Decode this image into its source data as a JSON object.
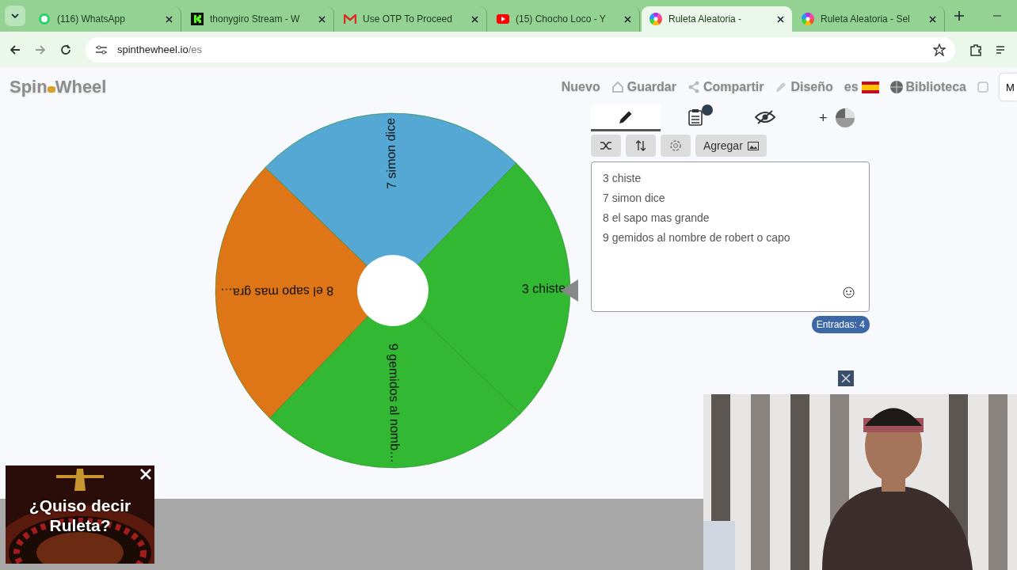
{
  "browser": {
    "tabs": [
      {
        "title": "(116) WhatsApp",
        "selected": false
      },
      {
        "title": "thonygiro Stream - W",
        "selected": false
      },
      {
        "title": "Use OTP To Proceed",
        "selected": false
      },
      {
        "title": "(15) Chocho Loco - Y",
        "selected": false
      },
      {
        "title": "Ruleta Aleatoria -",
        "selected": true
      },
      {
        "title": "Ruleta Aleatoria - Sel",
        "selected": false
      }
    ],
    "url_host": "spinthewheel.io",
    "url_path": "/es"
  },
  "site": {
    "logo_start": "Spin",
    "logo_end": "Wheel",
    "nav": [
      "Nuevo",
      "Guardar",
      "Compartir",
      "Diseño",
      "es",
      "Biblioteca"
    ],
    "edge_button": "M"
  },
  "wheel": {
    "slices": [
      {
        "label": "3 chiste",
        "color": "#33b833"
      },
      {
        "label": "9 gemidos al nomb…",
        "color": "#33b833"
      },
      {
        "label": "8 el sapo mas gra…",
        "color": "#de7516"
      },
      {
        "label": "7 simon dice",
        "color": "#55a8d4"
      }
    ]
  },
  "editor": {
    "tabs": [
      {
        "selected": true
      },
      {
        "selected": false
      },
      {
        "selected": false
      }
    ],
    "add_symbol": "+",
    "add_button": "Agregar",
    "entries": [
      "3 chiste",
      "7 simon dice",
      "8 el sapo mas grande",
      "9 gemidos al nombre de robert o capo"
    ],
    "count": "Entradas: 4"
  },
  "ad": {
    "kind": "picture",
    "text": "¿Quiso decir Ruleta?"
  }
}
